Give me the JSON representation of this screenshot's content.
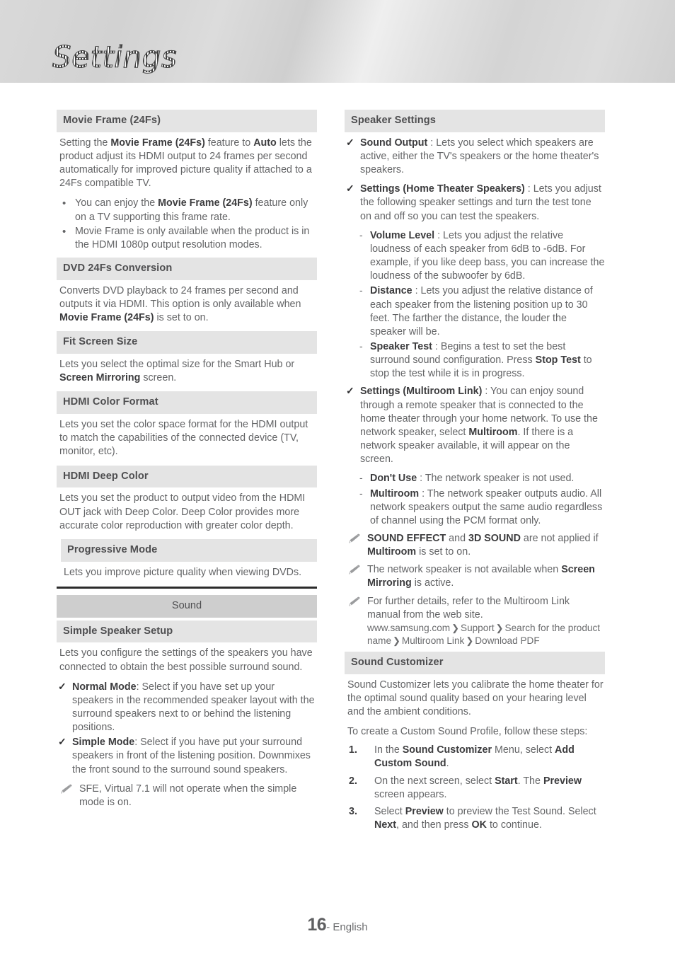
{
  "header": {
    "title": "Settings"
  },
  "footer": {
    "page_number": "16",
    "language": "- English"
  },
  "icons": {
    "bullet_dot": "•",
    "check": "✓",
    "dash": "-",
    "note": "pencil-note-icon",
    "chevron": "❯"
  },
  "left_column": {
    "movie_frame": {
      "heading": "Movie Frame (24Fs)",
      "paragraph": {
        "p1": "Setting the ",
        "b1": "Movie Frame (24Fs)",
        "p2": " feature to ",
        "b2": "Auto",
        "p3": " lets the product adjust its HDMI output to 24 frames per second automatically for improved picture quality if attached to a 24Fs compatible TV."
      },
      "bullets": [
        {
          "p1": "You can enjoy the ",
          "b1": "Movie Frame (24Fs)",
          "p2": " feature only on a TV supporting this frame rate."
        },
        {
          "p1": "Movie Frame is only available when the product is in the HDMI 1080p output resolution modes.",
          "b1": "",
          "p2": ""
        }
      ]
    },
    "dvd_24fs": {
      "heading": "DVD 24Fs Conversion",
      "paragraph": {
        "p1": "Converts DVD playback to 24 frames per second and outputs it via HDMI. This option is only available when ",
        "b1": "Movie Frame (24Fs)",
        "p2": " is set to on."
      }
    },
    "fit_screen": {
      "heading": "Fit Screen Size",
      "paragraph": {
        "p1": "Lets you select the optimal size for the Smart Hub or ",
        "b1": "Screen Mirroring",
        "p2": " screen."
      }
    },
    "hdmi_color_format": {
      "heading": "HDMI Color Format",
      "paragraph": "Lets you set the color space format for the HDMI output to match the capabilities of the connected device (TV, monitor, etc)."
    },
    "hdmi_deep_color": {
      "heading": "HDMI Deep Color",
      "paragraph": "Lets you set the product to output video from the HDMI OUT jack with Deep Color. Deep Color provides more accurate color reproduction with greater color depth."
    },
    "progressive_mode": {
      "heading": "Progressive Mode",
      "paragraph": "Lets you improve picture quality when viewing DVDs."
    },
    "sound_group": {
      "heading": "Sound"
    },
    "simple_speaker_setup": {
      "heading": "Simple Speaker Setup",
      "paragraph": "Lets you configure the settings of the speakers you have connected to obtain the best possible surround sound.",
      "checks": [
        {
          "b1": "Normal Mode",
          "p1": ": Select if you have set up your speakers in the recommended speaker layout with the surround speakers next to or behind the listening positions."
        },
        {
          "b1": "Simple Mode",
          "p1": ": Select if you have put your surround speakers in front of the listening position. Downmixes the front sound to the surround sound speakers."
        }
      ],
      "notes": [
        {
          "p1": "SFE, Virtual 7.1 will not operate when the simple mode is on."
        }
      ]
    }
  },
  "right_column": {
    "speaker_settings": {
      "heading": "Speaker Settings",
      "sound_output": {
        "b1": "Sound Output",
        "p1": " : Lets you select which speakers are active, either the TV's speakers or the home theater's speakers."
      },
      "settings_home_theater": {
        "b1": "Settings (Home Theater Speakers)",
        "p1": " : Lets you adjust the following speaker settings and turn the test tone on and off so you can test the speakers."
      },
      "home_theater_subitems": [
        {
          "b1": "Volume Level",
          "p1": " : Lets you adjust the relative loudness of each speaker from 6dB to -6dB. For example, if you like deep bass, you can increase the loudness of the subwoofer by 6dB.",
          "b2": "",
          "p2": ""
        },
        {
          "b1": "Distance",
          "p1": " : Lets you adjust the relative distance of each speaker from the listening position up to 30 feet. The farther the distance, the louder the speaker will be.",
          "b2": "",
          "p2": ""
        },
        {
          "b1": "Speaker Test",
          "p1": " : Begins a test to set the best surround sound configuration. Press ",
          "b2": "Stop Test",
          "p2": " to stop the test while it is in progress."
        }
      ],
      "settings_multiroom": {
        "b1": "Settings (Multiroom Link)",
        "p1": " : You can enjoy sound through a remote speaker that is connected to the home theater through your home network. To use the network speaker, select ",
        "b2": "Multiroom",
        "p2": ". If there is a network speaker available, it will appear on the screen."
      },
      "multiroom_subitems": [
        {
          "b1": "Don't Use",
          "p1": " : The network speaker is not used."
        },
        {
          "b1": "Multiroom",
          "p1": " : The network speaker outputs audio. All network speakers output the same audio regardless of channel using the PCM format only."
        }
      ],
      "notes": [
        {
          "b1": "SOUND EFFECT",
          "p1": " and ",
          "b2": "3D SOUND",
          "p2": " are not applied if ",
          "b3": "Multiroom",
          "p3": " is set to on."
        },
        {
          "b1": "",
          "p1": "The network speaker is not available when ",
          "b2": "Screen Mirroring",
          "p2": " is active.",
          "b3": "",
          "p3": ""
        }
      ],
      "web_note": {
        "text": "For further details, refer to the Multiroom Link manual from the web site.",
        "url_parts": [
          "www.samsung.com",
          "Support",
          "Search for the product name",
          "Multiroom Link",
          "Download PDF"
        ]
      }
    },
    "sound_customizer": {
      "heading": "Sound Customizer",
      "paragraph1": "Sound Customizer lets you calibrate the home theater for the optimal sound quality based on your hearing level and the ambient conditions.",
      "paragraph2": "To create a Custom Sound Profile, follow these steps:",
      "steps": [
        {
          "num": "1.",
          "p1": "In the ",
          "b1": "Sound Customizer",
          "p2": " Menu, select ",
          "b2": "Add Custom Sound",
          "p3": "."
        },
        {
          "num": "2.",
          "p1": "On the next screen, select ",
          "b1": "Start",
          "p2": ". The ",
          "b2": "Preview",
          "p3": " screen appears."
        },
        {
          "num": "3.",
          "p1": "Select ",
          "b1": "Preview",
          "p2": " to preview the Test Sound. Select ",
          "b2": "Next",
          "p3": ", and then press ",
          "b3": "OK",
          "p4": " to continue."
        }
      ]
    }
  }
}
